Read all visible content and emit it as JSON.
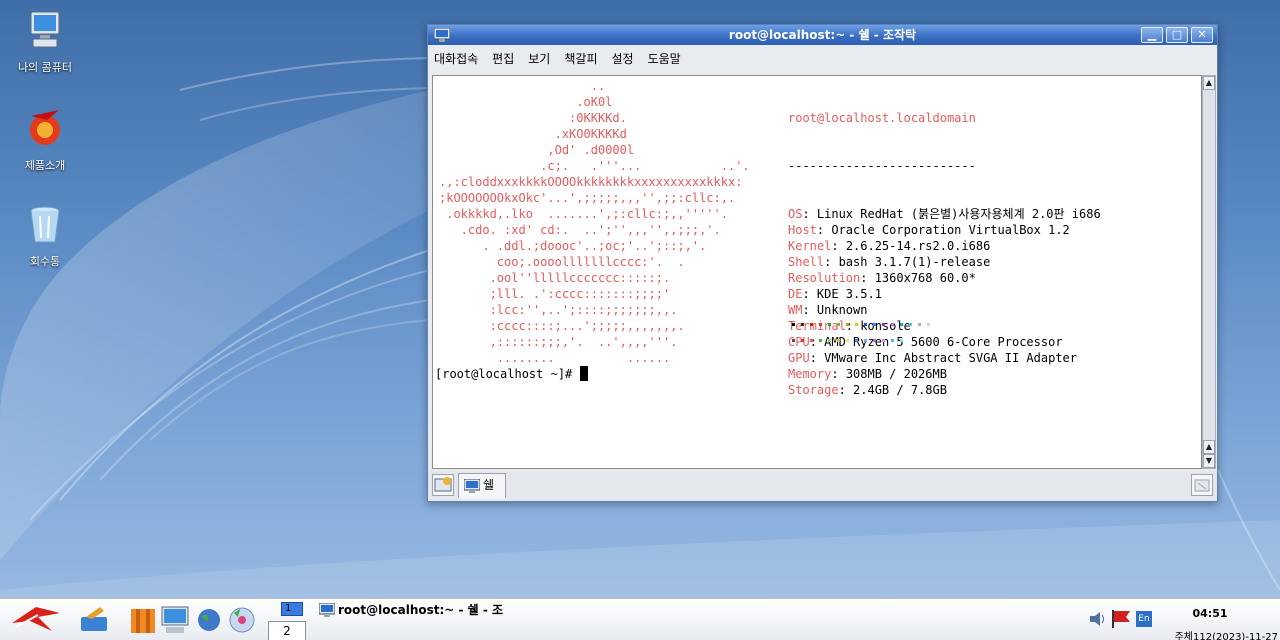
{
  "desktop": {
    "icons": [
      {
        "label": "나의 콤퓨터",
        "icon": "computer-icon"
      },
      {
        "label": "제품소개",
        "icon": "product-intro-icon"
      },
      {
        "label": "회수통",
        "icon": "trash-icon"
      }
    ]
  },
  "window": {
    "title": "root@localhost:~ - 쉘 - 조작탁",
    "buttons": {
      "minimize": "▁",
      "maximize": "□",
      "close": "✕"
    },
    "menu": [
      "대화접속",
      "편집",
      "보기",
      "책갈피",
      "설정",
      "도움말"
    ],
    "terminal": {
      "logo": "                     ..\n                   .oK0l\n                  :0KKKKd.\n                .xKO0KKKKd\n               ,Od' .d0000l\n              .c;.   .'''...           ..'.\n.,:cloddxxxkkkkOOOOkkkkkkkkxxxxxxxxxxkkkx:\n;kOOOOOOOkxOkc'...',;;;;;,,,'',;;:cllc:,.\n .okkkkd,.lko  .......',;:cllc:;,,'''''.\n   .cdo. :xd' cd:.  ..';'',,,'',,;;;,'.\n      . .ddl.;doooc'..;oc;'..';::;,'.\n        coo;.oooolllllllcccc:'.  .\n       .ool''lllllccccccc:::::;.\n       ;lll. .':cccc:::::::;;;;'\n       :lcc:'',..';::::;;;;;;;,,.\n       :cccc::::;...';;;;;,,,,,,,.\n       ,::::::;;;,'.  ..',,,,'''.\n        ........          ......",
      "user_host": "root@localhost.localdomain",
      "separator": "--------------------------",
      "fields": [
        {
          "key": "OS",
          "value": "Linux RedHat (붉은별)사용자용체계 2.0판 i686"
        },
        {
          "key": "Host",
          "value": "Oracle Corporation VirtualBox 1.2"
        },
        {
          "key": "Kernel",
          "value": "2.6.25-14.rs2.0.i686"
        },
        {
          "key": "Shell",
          "value": "bash 3.1.7(1)-release"
        },
        {
          "key": "Resolution",
          "value": "1360x768 60.0*"
        },
        {
          "key": "DE",
          "value": "KDE 3.5.1"
        },
        {
          "key": "WM",
          "value": "Unknown"
        },
        {
          "key": "Terminal",
          "value": "konsole"
        },
        {
          "key": "CPU",
          "value": "AMD Ryzen 5 5600 6-Core Processor"
        },
        {
          "key": "GPU",
          "value": "VMware Inc Abstract SVGA II Adapter"
        },
        {
          "key": "Memory",
          "value": "308MB / 2026MB"
        },
        {
          "key": "Storage",
          "value": "2.4GB / 7.8GB"
        }
      ],
      "palette_row1": [
        "#000000",
        "#333333",
        "#d02020",
        "#e83030",
        "#28a028",
        "#50c850",
        "#c8a000",
        "#e8c800",
        "#2050d0",
        "#4080f0",
        "#a030b0",
        "#d060e0",
        "#20a0b0",
        "#40d0e0",
        "#b0b0b0",
        "#d8d8d8"
      ],
      "palette_row2": [
        "#555555",
        "#d04040",
        "#e86060",
        "#50b050",
        "#80d880",
        "#d8c040",
        "#f0e060",
        "#5080e0",
        "#80a8f8",
        "#c060d0",
        "#e090f0",
        "#50c0d0",
        "#80e8f0"
      ],
      "prompt": "[root@localhost ~]# "
    },
    "tab": {
      "label": "쉘",
      "icon": "terminal-icon"
    }
  },
  "taskbar": {
    "pager": [
      "1",
      "2"
    ],
    "task_title": "root@localhost:~ - 쉘 - 조",
    "clock": "04:51",
    "date": "주체112(2023)-11-27",
    "lang": "En"
  }
}
